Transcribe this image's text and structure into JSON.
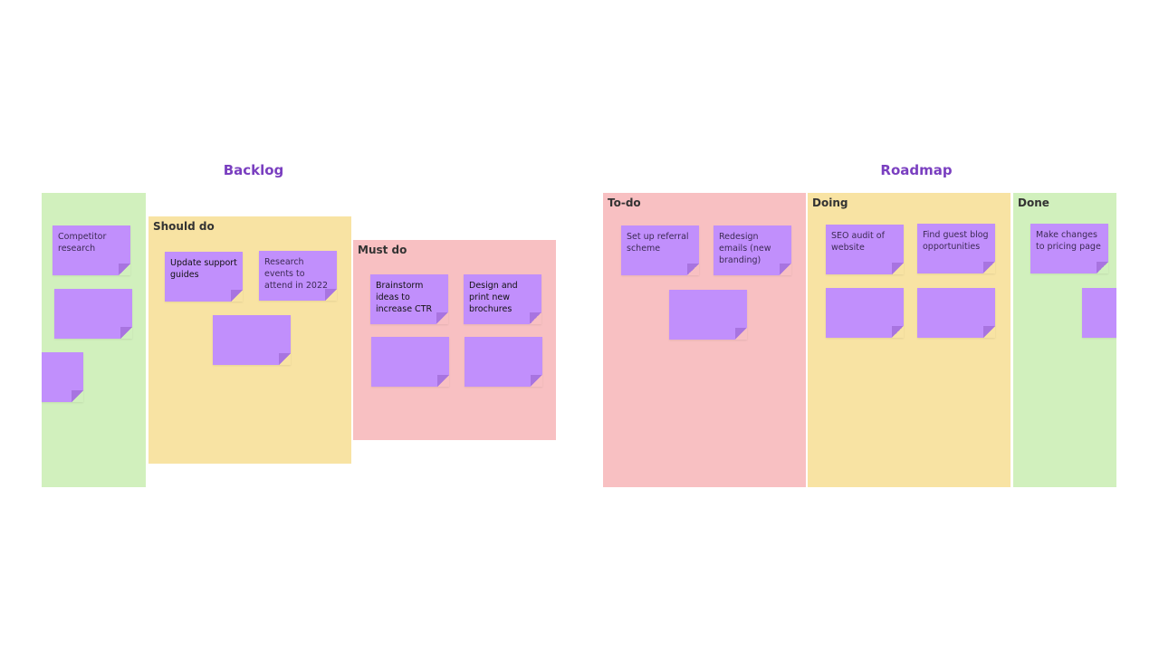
{
  "boards": {
    "backlog": {
      "title": "Backlog",
      "frames": {
        "ideas": {
          "label": "",
          "notes": [
            "Competitor research",
            "",
            ""
          ]
        },
        "should_do": {
          "label": "Should do",
          "notes": [
            "Update support guides",
            "Research events to attend in 2022",
            ""
          ]
        },
        "must_do": {
          "label": "Must do",
          "notes": [
            "Brainstorm ideas to increase CTR",
            "Design and print new brochures",
            "",
            ""
          ]
        }
      }
    },
    "roadmap": {
      "title": "Roadmap",
      "frames": {
        "todo": {
          "label": "To-do",
          "notes": [
            "Set up referral scheme",
            "Redesign emails (new branding)",
            ""
          ]
        },
        "doing": {
          "label": "Doing",
          "notes": [
            "SEO audit of website",
            "Find guest blog opportunities",
            "",
            ""
          ]
        },
        "done": {
          "label": "Done",
          "notes": [
            "Make changes to pricing page",
            ""
          ]
        }
      }
    }
  },
  "colors": {
    "title": "#7a3fc0",
    "green_frame": "#d1f0bd",
    "yellow_frame": "#f8e3a3",
    "pink_frame": "#f8c0c2",
    "sticky_note": "#c18ffc"
  }
}
